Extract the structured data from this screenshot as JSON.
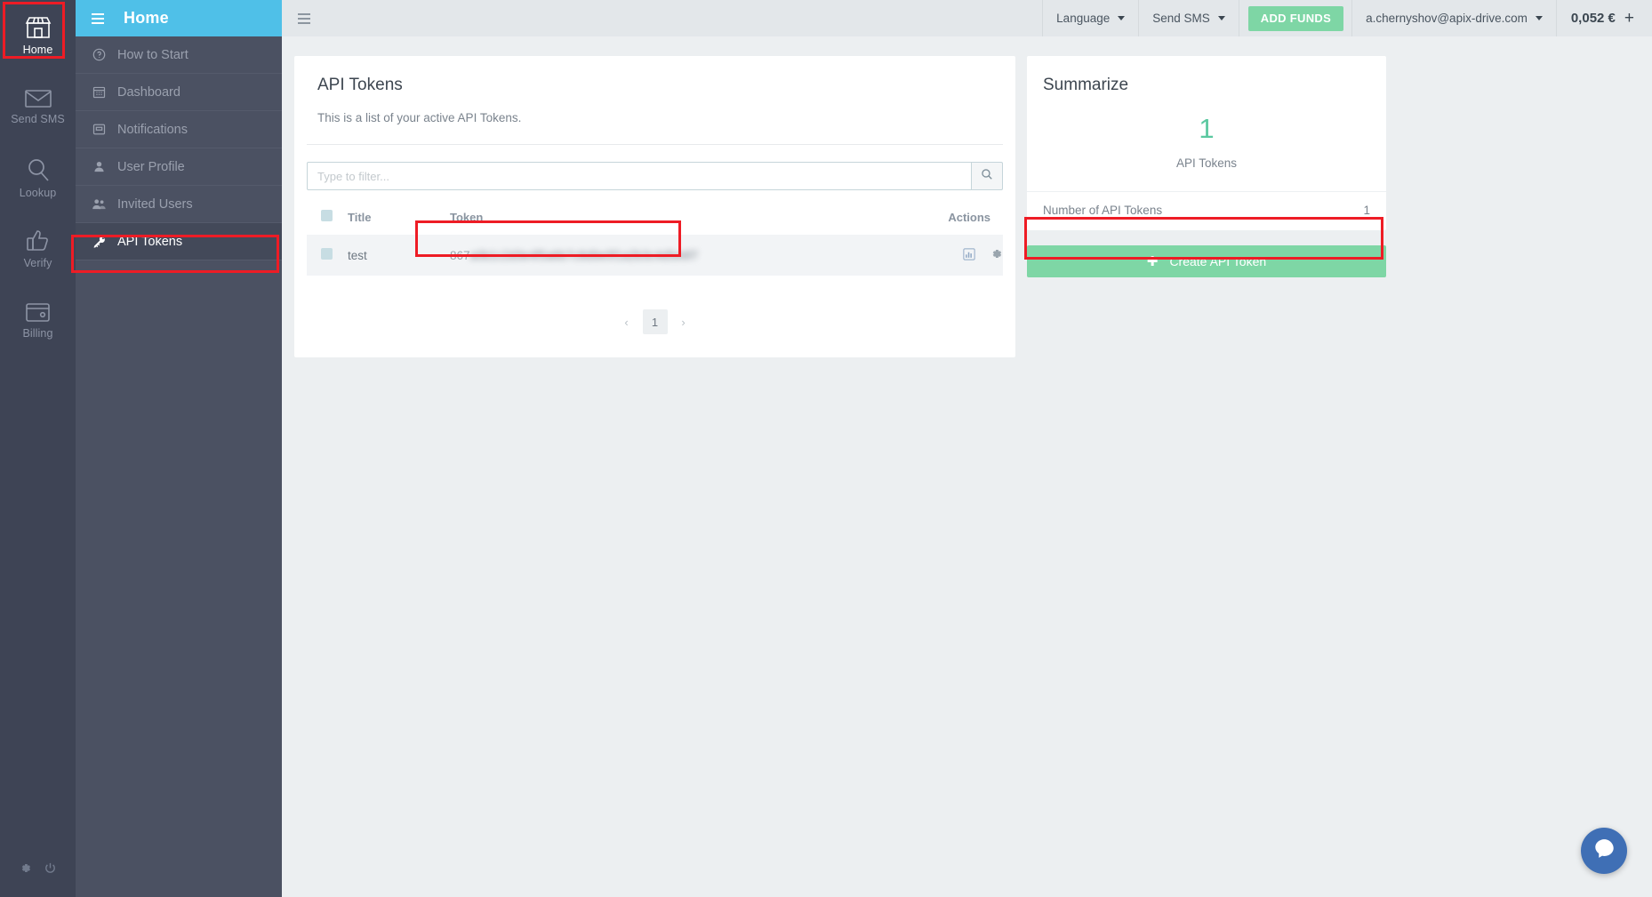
{
  "rail": {
    "items": [
      {
        "label": "Home",
        "icon": "store-icon",
        "active": true
      },
      {
        "label": "Send SMS",
        "icon": "envelope-icon",
        "active": false
      },
      {
        "label": "Lookup",
        "icon": "magnifier-icon",
        "active": false
      },
      {
        "label": "Verify",
        "icon": "thumbs-up-icon",
        "active": false
      },
      {
        "label": "Billing",
        "icon": "wallet-icon",
        "active": false
      }
    ],
    "bottom": [
      {
        "icon": "gear-icon"
      },
      {
        "icon": "power-icon"
      }
    ]
  },
  "nav": {
    "title": "Home",
    "items": [
      {
        "label": "How to Start",
        "icon": "question-circle-icon",
        "active": false
      },
      {
        "label": "Dashboard",
        "icon": "calendar-icon",
        "active": false
      },
      {
        "label": "Notifications",
        "icon": "inbox-icon",
        "active": false
      },
      {
        "label": "User Profile",
        "icon": "user-icon",
        "active": false
      },
      {
        "label": "Invited Users",
        "icon": "users-icon",
        "active": false
      },
      {
        "label": "API Tokens",
        "icon": "key-icon",
        "active": true
      }
    ]
  },
  "topbar": {
    "language_label": "Language",
    "send_sms_label": "Send SMS",
    "add_funds_label": "ADD FUNDS",
    "account_email": "a.chernyshov@apix-drive.com",
    "balance": "0,052 €",
    "plus_label": "+"
  },
  "main": {
    "title": "API Tokens",
    "subtitle": "This is a list of your active API Tokens.",
    "filter_placeholder": "Type to filter...",
    "filter_value": "",
    "columns": [
      "Title",
      "Token",
      "Actions"
    ],
    "rows": [
      {
        "title": "test",
        "token_visible": "867",
        "token_hidden": "a0b1c2d3e4f5a6b7c8d9e0f1a2b3c4d5e6f7"
      }
    ],
    "pagination": {
      "prev": "‹",
      "next": "›",
      "pages": [
        "1"
      ],
      "current": "1"
    }
  },
  "summarize": {
    "title": "Summarize",
    "big_number": "1",
    "big_label": "API Tokens",
    "row_label": "Number of API Tokens",
    "row_value": "1",
    "create_button": "Create API Token",
    "create_icon": "plus-icon"
  },
  "colors": {
    "accent_blue": "#4fc0e8",
    "accent_green": "#7ed6a5",
    "summary_green": "#5bc8a0",
    "rail_dark": "#3e4455",
    "nav_dark": "#4b5162",
    "highlight_red": "#ee1c25"
  }
}
